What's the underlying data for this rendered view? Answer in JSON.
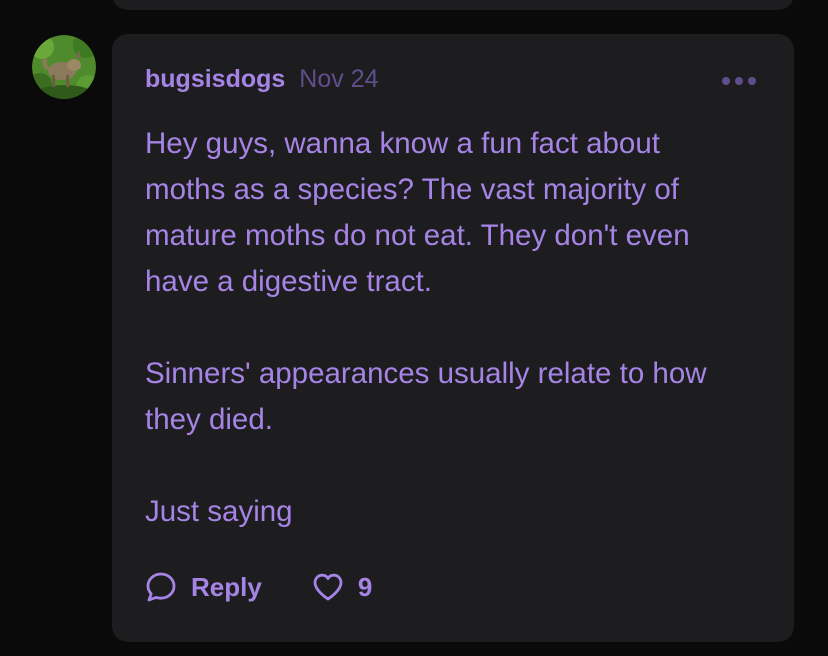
{
  "comment": {
    "username": "bugsisdogs",
    "date": "Nov 24",
    "body_lines": [
      "Hey guys, wanna know a fun fact about",
      "moths as a species? The vast majority of",
      "mature moths do not eat. They don't even",
      "have a digestive tract.",
      "",
      "Sinners' appearances usually relate to how",
      "they died.",
      "",
      "Just saying"
    ],
    "reply_label": "Reply",
    "like_count": "9"
  },
  "colors": {
    "background": "#0a0a0a",
    "card": "#1d1d1f",
    "accent": "#a684e6",
    "muted_accent": "#5f4e8c"
  },
  "icons": {
    "more": "more-dots-icon",
    "reply": "speech-bubble-icon",
    "like": "heart-icon"
  }
}
